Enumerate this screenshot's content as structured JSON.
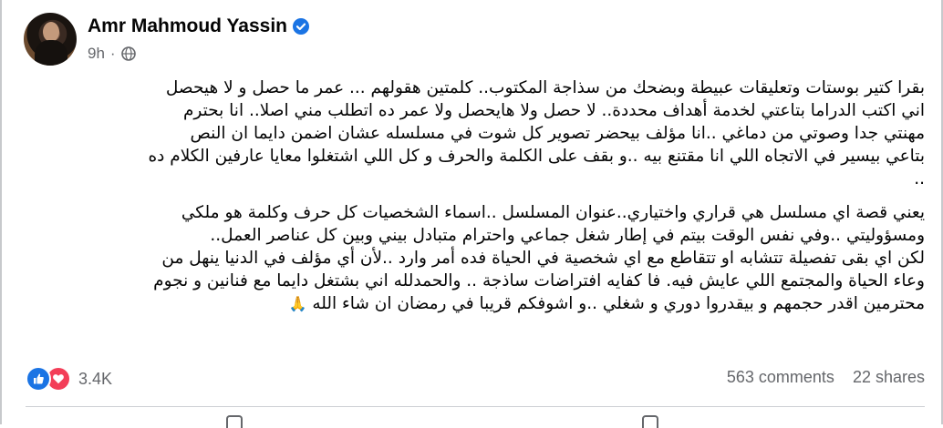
{
  "post": {
    "author": {
      "name": "Amr Mahmoud Yassin",
      "verified": true
    },
    "meta": {
      "time": "9h",
      "separator": "·",
      "audience_icon": "globe-icon"
    },
    "text_lines": [
      "بقرا كتير  بوستات وتعليقات عبيطة وبضحك من سذاجة المكتوب.. كلمتين هقولهم ... عمر ما حصل و لا هيحصل",
      "اني اكتب الدراما بتاعتي لخدمة  أهداف محددة.. لا حصل ولا هايحصل ولا عمر ده اتطلب مني اصلا..  انا بحترم",
      "مهنتي جدا وصوتي من دماغي   ..انا  مؤلف بيحضر تصوير كل شوت في مسلسله عشان اضمن دايما ان النص",
      "بتاعي بيسير في الاتجاه اللي انا مقتنع بيه ..و بقف على الكلمة والحرف و كل اللي اشتغلوا معايا عارفين الكلام ده",
      "..",
      "",
      "يعني قصة اي مسلسل هي قراري واختياري..عنوان المسلسل ..اسماء الشخصيات كل حرف وكلمة هو ملكي",
      "ومسؤوليتي ..وفي نفس الوقت بيتم في إطار شغل جماعي واحترام متبادل بيني وبين كل عناصر العمل..",
      "لكن اي بقى تفصيلة تتشابه او تتقاطع مع اي شخصية في الحياة فده أمر وارد ..لأن أي مؤلف في الدنيا ينهل من",
      "وعاء الحياة والمجتمع اللي عايش فيه. فا كفايه افتراضات ساذجة .. والحمدلله اني بشتغل دايما مع فنانين و نجوم",
      "محترمين اقدر حجمهم و بيقدروا دوري و شغلي ..و اشوفكم قريبا  في رمضان  ان شاء الله"
    ],
    "trailing_emoji": "🙏",
    "reactions": {
      "icons": [
        "like-icon",
        "love-icon"
      ],
      "count": "3.4K"
    },
    "stats": {
      "comments": "563 comments",
      "shares": "22 shares"
    }
  },
  "colors": {
    "verified_blue": "#1b74e4",
    "like_blue": "#1b74e4",
    "love_red": "#f33e58",
    "secondary_text": "#65676b"
  }
}
